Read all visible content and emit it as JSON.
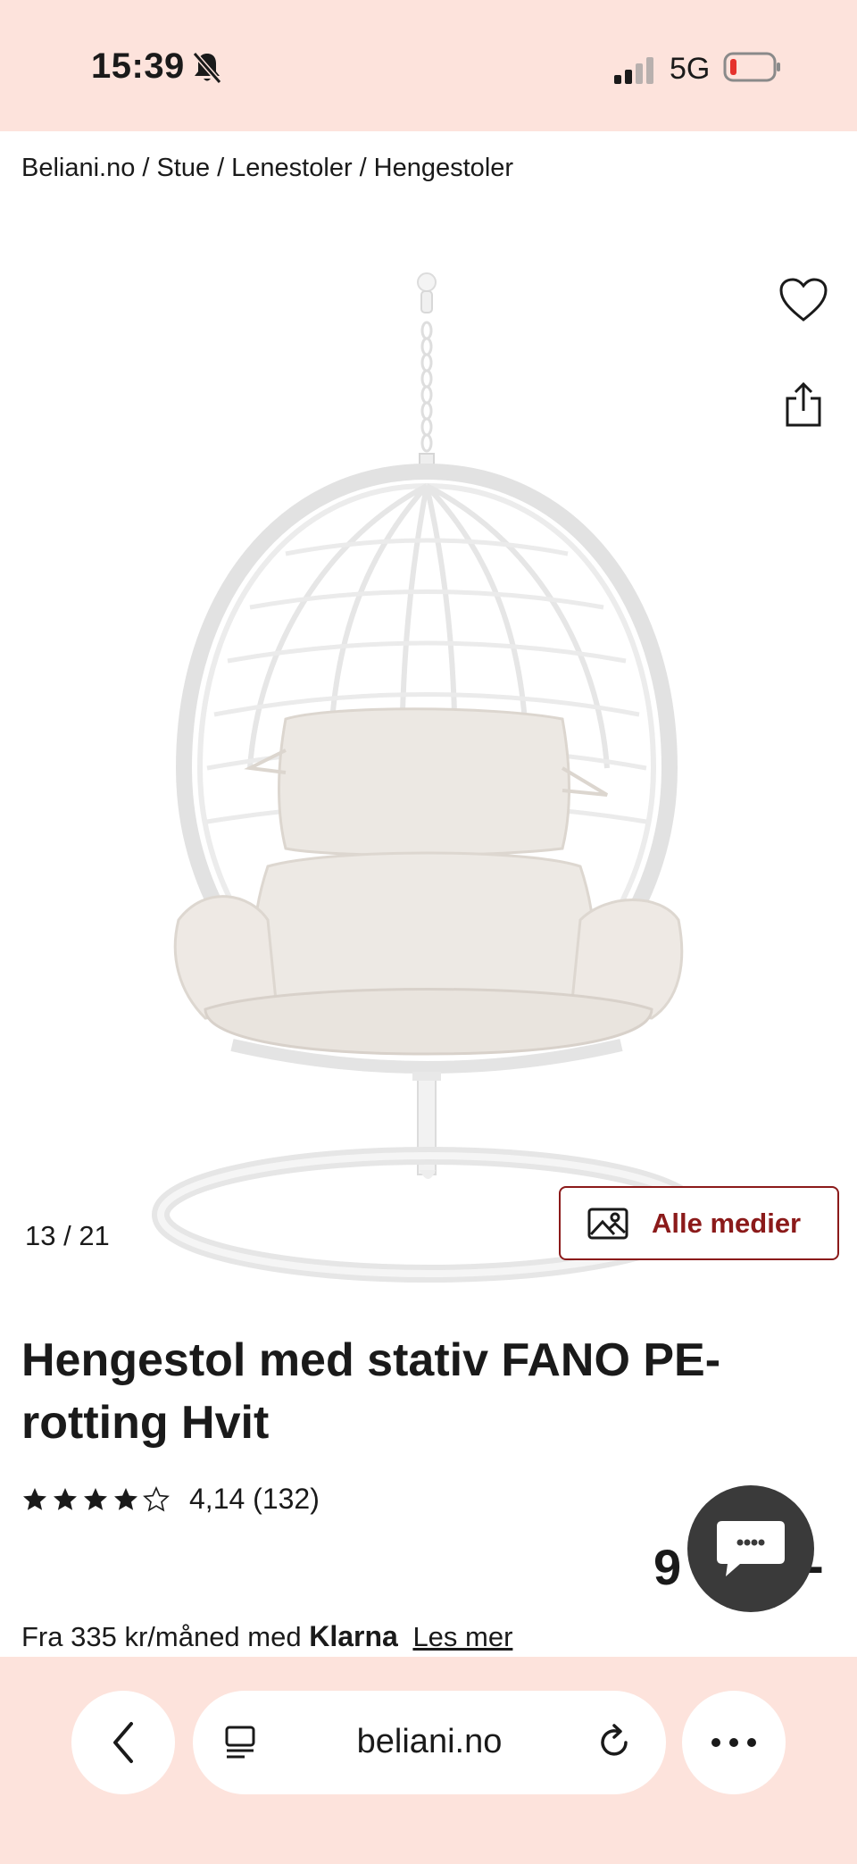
{
  "status_bar": {
    "time": "15:39",
    "network": "5G",
    "icons": [
      "bell-slash-icon",
      "signal-icon",
      "battery-icon"
    ],
    "background": "#fde3dc"
  },
  "breadcrumb": {
    "items": [
      "Beliani.no",
      "Stue",
      "Lenestoler",
      "Hengestoler"
    ],
    "separator": "/"
  },
  "gallery": {
    "counter": "13 / 21",
    "media_button_label": "Alle medier",
    "icons": [
      "heart-icon",
      "share-icon",
      "image-icon"
    ]
  },
  "product": {
    "title": "Hengestol med stativ FANO PE-rotting Hvit",
    "rating_value": "4,14",
    "rating_count": "(132)",
    "stars_filled": 4,
    "stars_total": 5,
    "price_visible": "9",
    "price_suffix": "-"
  },
  "financing": {
    "text": "Fra 335 kr/måned med",
    "brand": "Klarna",
    "link": "Les mer"
  },
  "browser_bar": {
    "url": "beliani.no",
    "icons": [
      "chevron-left-icon",
      "reader-icon",
      "reload-icon",
      "more-icon"
    ]
  },
  "colors": {
    "accent": "#8b1a1a",
    "chat_bg": "#3a3a3a"
  }
}
